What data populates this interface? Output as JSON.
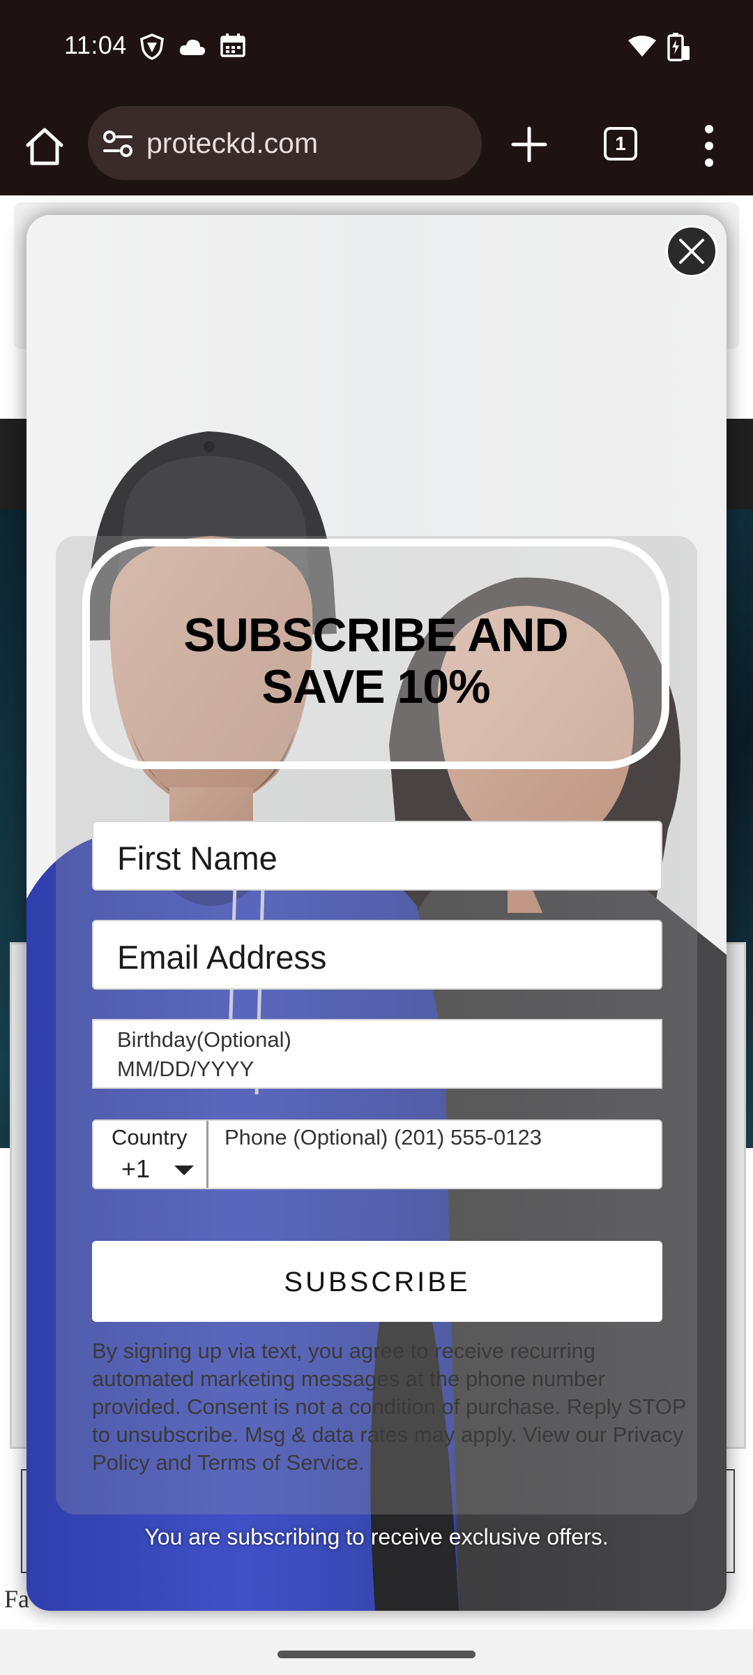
{
  "status_bar": {
    "time": "11:04"
  },
  "browser": {
    "url": "proteckd.com",
    "tab_count": "1"
  },
  "popup": {
    "headline_line1": "SUBSCRIBE AND",
    "headline_line2": "SAVE 10%",
    "first_name_placeholder": "First Name",
    "email_placeholder": "Email Address",
    "birthday_label": "Birthday(Optional)",
    "birthday_placeholder": "MM/DD/YYYY",
    "country_label": "Country",
    "country_code": "+1",
    "phone_placeholder": "Phone (Optional) (201) 555-0123",
    "subscribe_label": "SUBSCRIBE",
    "disclaimer_pre": "By signing up via text, you agree to receive recurring automated marketing messages at the phone number provided. Consent is not a condition of purchase. Reply STOP to unsubscribe. Msg & data rates may apply. View our ",
    "privacy_link": "Privacy Policy",
    "disclaimer_and": " and ",
    "terms_link": "Terms of Service",
    "disclaimer_end": ".",
    "offers_text": "You are subscribing to receive exclusive offers."
  },
  "background_page": {
    "footer_text": "Fa"
  },
  "colors": {
    "system_bar": "#1e1212",
    "url_bar": "#3a2b2a",
    "hoodie_blue": "#2f3fb8",
    "close_button": "#2a2a2a"
  }
}
